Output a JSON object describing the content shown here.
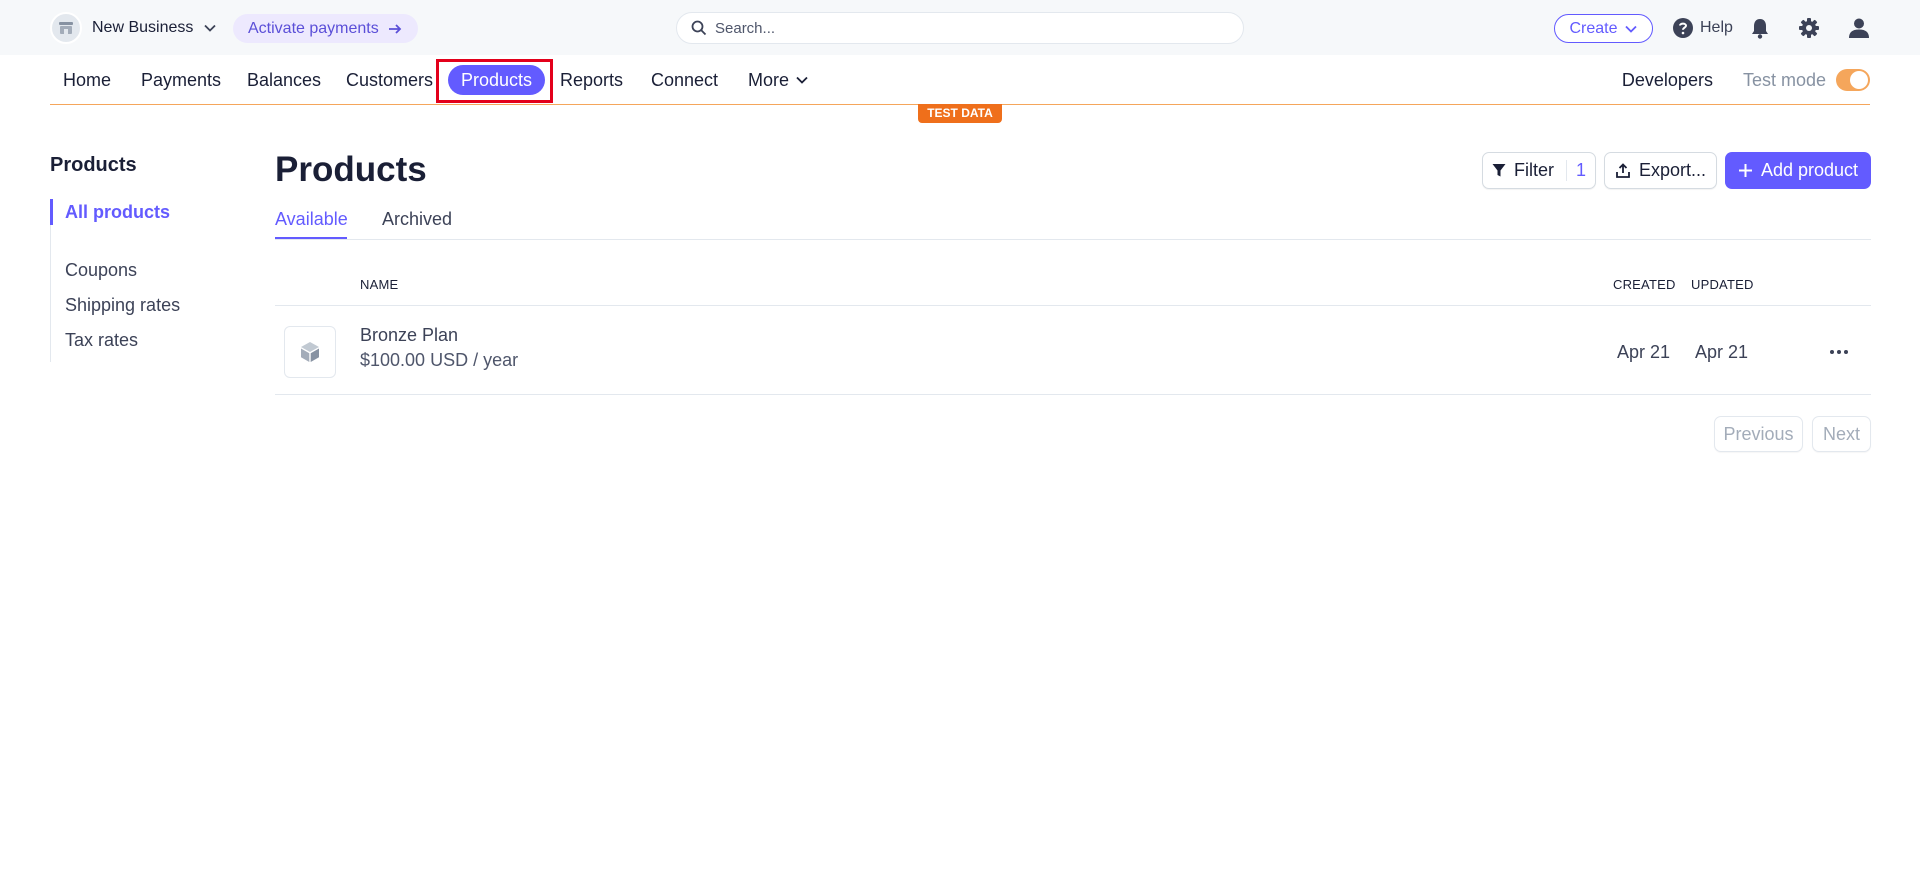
{
  "topbar": {
    "business_name": "New Business",
    "activate_label": "Activate payments",
    "search_placeholder": "Search...",
    "create_label": "Create",
    "help_label": "Help"
  },
  "nav": {
    "items": [
      "Home",
      "Payments",
      "Balances",
      "Customers",
      "Products",
      "Reports",
      "Connect",
      "More"
    ],
    "active": "Products",
    "developers_label": "Developers",
    "test_mode_label": "Test mode",
    "test_mode_on": true,
    "test_data_badge": "TEST DATA"
  },
  "sidebar": {
    "title": "Products",
    "items": [
      "All products",
      "Coupons",
      "Shipping rates",
      "Tax rates"
    ],
    "active": "All products"
  },
  "main": {
    "title": "Products",
    "filter_label": "Filter",
    "filter_count": "1",
    "export_label": "Export...",
    "add_label": "Add product",
    "tabs": [
      "Available",
      "Archived"
    ],
    "active_tab": "Available",
    "columns": {
      "name": "NAME",
      "created": "CREATED",
      "updated": "UPDATED"
    },
    "rows": [
      {
        "name": "Bronze Plan",
        "price": "$100.00 USD / year",
        "created": "Apr 21",
        "updated": "Apr 21"
      }
    ],
    "pagination": {
      "previous": "Previous",
      "next": "Next"
    }
  },
  "colors": {
    "accent": "#635bff",
    "test_mode": "#f5a65b",
    "highlight": "#e3001b"
  }
}
